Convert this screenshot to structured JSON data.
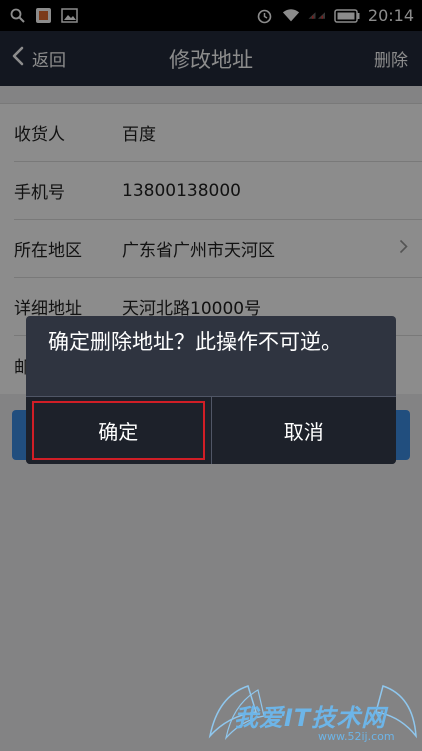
{
  "status_bar": {
    "time": "20:14",
    "icons": [
      "search-icon",
      "app-icon",
      "image-icon",
      "alarm-icon",
      "wifi-icon",
      "signal-icon",
      "battery-icon"
    ]
  },
  "nav": {
    "back_label": "返回",
    "title": "修改地址",
    "delete_label": "删除"
  },
  "form": {
    "rows": [
      {
        "label": "收货人",
        "value": "百度"
      },
      {
        "label": "手机号",
        "value": "13800138000"
      },
      {
        "label": "所在地区",
        "value": "广东省广州市天河区"
      },
      {
        "label": "详细地址",
        "value": "天河北路10000号"
      },
      {
        "label": "邮",
        "value": ""
      }
    ]
  },
  "dialog": {
    "message": "确定删除地址？此操作不可逆。",
    "confirm_label": "确定",
    "cancel_label": "取消"
  },
  "watermark": {
    "text": "我爱IT技术网",
    "url": "www.52ij.com"
  },
  "colors": {
    "navbar": "#232b3b",
    "accent_blue": "#3d8ee6",
    "highlight_red": "#d11e26",
    "dialog_bg": "#2f3440"
  }
}
